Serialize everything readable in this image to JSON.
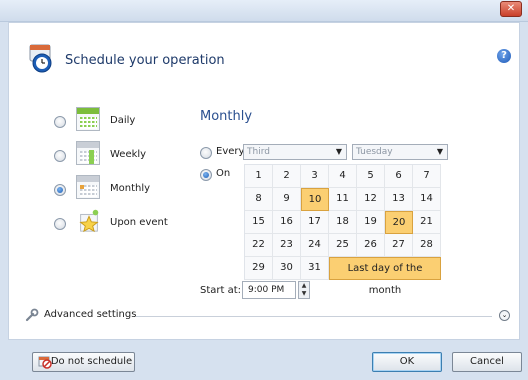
{
  "header": {
    "title": "Schedule your operation"
  },
  "schedule_options": [
    {
      "label": "Daily",
      "selected": false,
      "icon": "daily-calendar-icon"
    },
    {
      "label": "Weekly",
      "selected": false,
      "icon": "weekly-calendar-icon"
    },
    {
      "label": "Monthly",
      "selected": true,
      "icon": "monthly-calendar-icon"
    },
    {
      "label": "Upon event",
      "selected": false,
      "icon": "star-event-icon"
    }
  ],
  "monthly": {
    "title": "Monthly",
    "every_label": "Every",
    "on_label": "On",
    "every_week_value": "Third",
    "every_day_value": "Tuesday",
    "selected_mode": "On",
    "days": [
      "1",
      "2",
      "3",
      "4",
      "5",
      "6",
      "7",
      "8",
      "9",
      "10",
      "11",
      "12",
      "13",
      "14",
      "15",
      "16",
      "17",
      "18",
      "19",
      "20",
      "21",
      "22",
      "23",
      "24",
      "25",
      "26",
      "27",
      "28",
      "29",
      "30",
      "31"
    ],
    "selected_days": [
      "10",
      "20"
    ],
    "last_day_label": "Last day of the month",
    "last_day_selected": true
  },
  "start": {
    "label": "Start at:",
    "time": "9:00 PM"
  },
  "advanced": {
    "label": "Advanced settings"
  },
  "footer": {
    "no_schedule_label": "Do not schedule",
    "ok_label": "OK",
    "cancel_label": "Cancel"
  },
  "colors": {
    "accent": "#2a4f8f",
    "selected_day": "#fbcf72",
    "title_bar": "#d6e1ef"
  }
}
